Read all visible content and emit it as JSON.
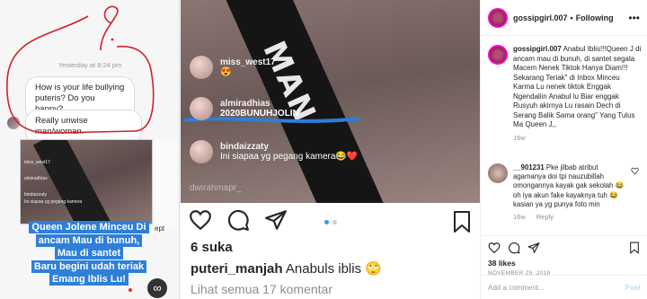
{
  "left_panel": {
    "timestamp": "Yesterday at 8:24 pm",
    "message_1": "How is your life bullying puteris? Do you happy?",
    "message_2": "Really unwise man/woman.",
    "inner_names": [
      "miss_west17",
      "almiradhias",
      "bindaizzaty"
    ],
    "inner_comment": "Ini siapaa yg pegang kamera",
    "strip_text": "ept",
    "caption_lines": [
      "Queen Jolene Minceu Di",
      "ancam Mau di bunuh,",
      "Mau di santet",
      "Baru begini udah teriak",
      "Emang Iblis Lu!"
    ],
    "infinity": "∞"
  },
  "media": {
    "sash_text": "MAN",
    "comments": [
      {
        "name": "miss_west17",
        "text": "😍"
      },
      {
        "name": "almiradhias",
        "text": "2020BUNUHJOLIN"
      },
      {
        "name": "bindaizzaty",
        "text": "Ini siapaa yg pegang kamera😂❤️"
      },
      {
        "name": "dwirahmapr_",
        "text": ""
      }
    ]
  },
  "post": {
    "likes": "6 suka",
    "caption_user": "puteri_manjah",
    "caption_text": "Anabuls iblis 🙄",
    "see_all": "Lihat semua 17 komentar"
  },
  "sidebar": {
    "username": "gossipgirl.007",
    "separator": "•",
    "follow": "Following",
    "more": "•••",
    "caption_user": "gossipgirl.007",
    "caption_text": "Anabul Iblis!!!Queen J di ancam mau di bunuh, di santet segala Macem Nenek Tiktok Hanya Diam!!! Sekarang Teriak\" di Inbox Minceu Karma Lu nenek tiktok Enggak Ngendaliin Anabul lu Biar enggak Rusyuh akirnya Lu rasain Dech di Serang Balik Sama orang\" Yang Tulus Ma Queen J,,",
    "caption_meta": "16w",
    "comment_user": "__901231",
    "comment_text": "Pke jilbab atribut agamanya doi tpi nauzubillah omongannya kayak gak sekolah 😂 oh iya akun fake kayaknya tuh 😂 kasian ya yg punya foto min",
    "comment_meta": [
      "16w",
      "Reply"
    ],
    "likes": "38 likes",
    "date": "NOVEMBER 25, 2019",
    "add_comment_placeholder": "Add a comment...",
    "post_label": "Post"
  },
  "colors": {
    "caption_blue": "#2e7fd8",
    "scribble_red": "#d1202a",
    "ig_blue": "#3897f0"
  }
}
